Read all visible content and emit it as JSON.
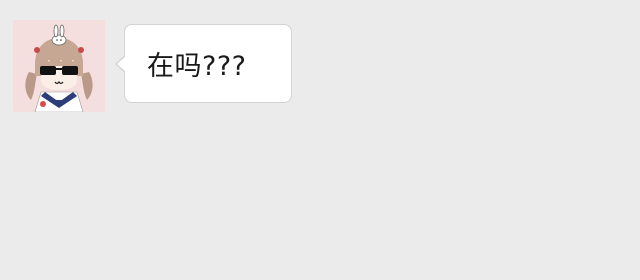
{
  "chat": {
    "messages": [
      {
        "sender": "incoming",
        "avatar": "anime-girl-avatar-icon",
        "text": "在吗???"
      }
    ]
  },
  "colors": {
    "background": "#ebebeb",
    "bubble": "#ffffff",
    "bubble_border": "#d3d3d3",
    "avatar_bg": "#f5dede"
  }
}
